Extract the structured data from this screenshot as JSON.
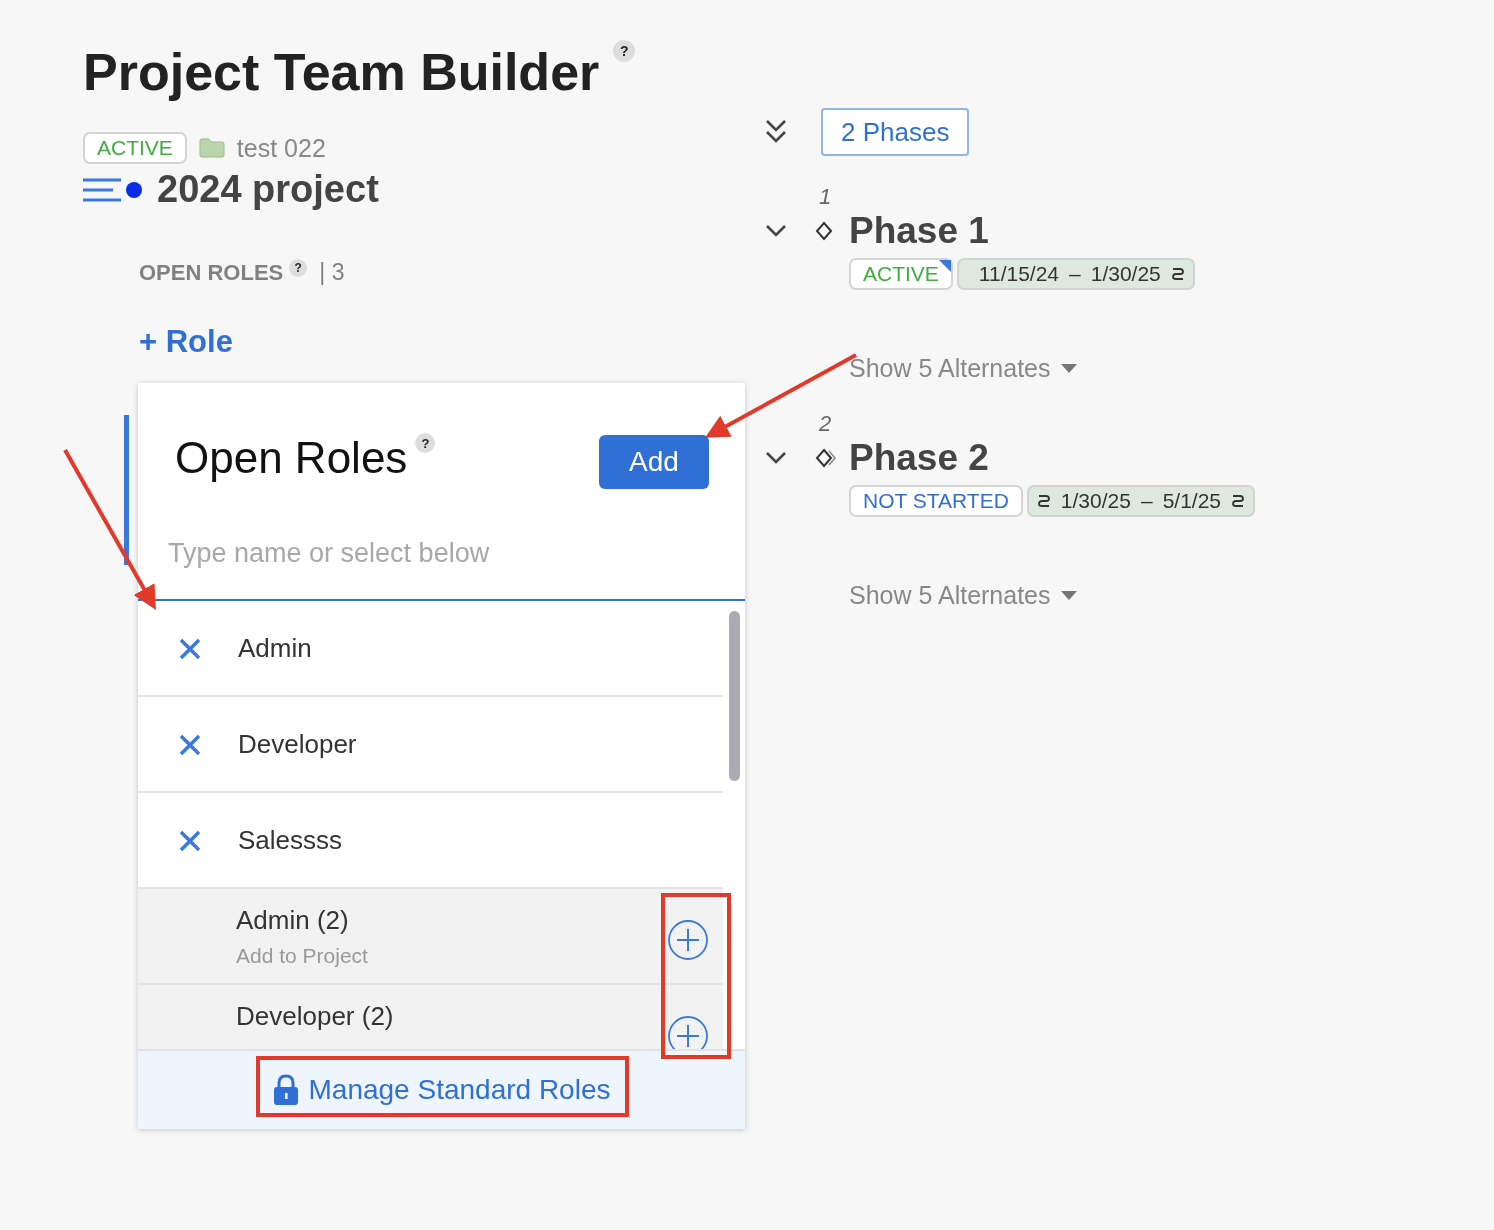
{
  "page": {
    "title": "Project Team Builder",
    "help": "?"
  },
  "project": {
    "status": "ACTIVE",
    "folder": "test 022",
    "name": "2024 project"
  },
  "open_roles": {
    "label": "OPEN ROLES",
    "help": "?",
    "divider": "|",
    "count": "3",
    "add_link": "+ Role"
  },
  "popup": {
    "title": "Open Roles",
    "help": "?",
    "add_button": "Add",
    "search": {
      "placeholder": "Type name or select below"
    },
    "items": [
      {
        "kind": "selected",
        "name": "Admin"
      },
      {
        "kind": "selected",
        "name": "Developer"
      },
      {
        "kind": "selected",
        "name": "Salessss"
      },
      {
        "kind": "candidate",
        "name": "Admin (2)",
        "hint": "Add to Project"
      },
      {
        "kind": "candidate",
        "name": "Developer (2)"
      }
    ],
    "footer_link": "Manage Standard Roles"
  },
  "phases": {
    "toggle_label": "2 Phases",
    "items": [
      {
        "number": "1",
        "name": "Phase 1",
        "expanded": true,
        "kind": "current",
        "status": {
          "label": "ACTIVE",
          "kind": "active"
        },
        "start": "11/15/24",
        "separator": "–",
        "end": "1/30/25",
        "start_linked": false,
        "end_linked": true,
        "alternates": "Show 5 Alternates"
      },
      {
        "number": "2",
        "name": "Phase 2",
        "expanded": true,
        "kind": "next",
        "status": {
          "label": "NOT STARTED",
          "kind": "not_started"
        },
        "start": "1/30/25",
        "separator": "–",
        "end": "5/1/25",
        "start_linked": true,
        "end_linked": true,
        "alternates": "Show 5 Alternates"
      }
    ]
  }
}
